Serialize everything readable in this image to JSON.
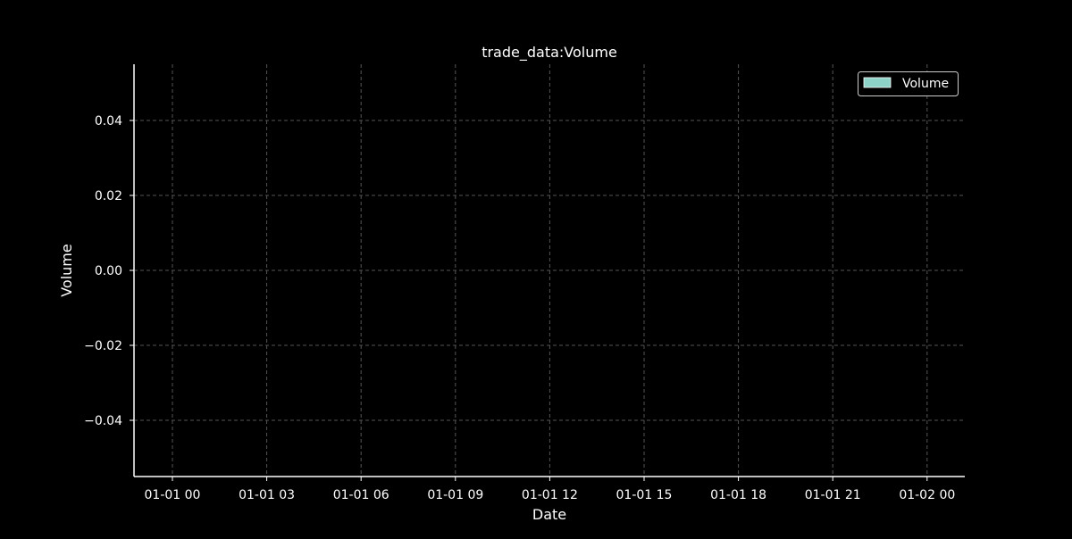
{
  "chart_data": {
    "type": "bar",
    "title": "trade_data:Volume",
    "xlabel": "Date",
    "ylabel": "Volume",
    "x_ticks": [
      "01-01 00",
      "01-01 03",
      "01-01 06",
      "01-01 09",
      "01-01 12",
      "01-01 15",
      "01-01 18",
      "01-01 21",
      "01-02 00"
    ],
    "y_ticks": [
      "0.04",
      "0.02",
      "0.00",
      "−0.02",
      "−0.04"
    ],
    "y_tick_values": [
      0.04,
      0.02,
      0.0,
      -0.02,
      -0.04
    ],
    "ylim": [
      -0.055,
      0.055
    ],
    "series": [
      {
        "name": "Volume",
        "values": []
      }
    ],
    "grid": true,
    "legend_position": "top-right"
  },
  "colors": {
    "background": "#000000",
    "axis": "#ffffff",
    "grid": "#555555",
    "volume": "#8dd3c7"
  }
}
